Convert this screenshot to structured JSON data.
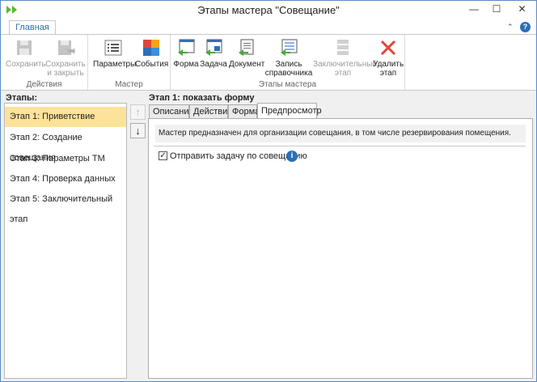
{
  "window": {
    "title": "Этапы мастера \"Совещание\""
  },
  "ribbon": {
    "tab_home": "Главная",
    "groups": {
      "actions": "Действия",
      "master": "Мастер",
      "stages": "Этапы мастера"
    },
    "buttons": {
      "save": "Сохранить",
      "save_close_1": "Сохранить",
      "save_close_2": "и закрыть",
      "params": "Параметры",
      "events": "События",
      "form": "Форма",
      "task": "Задача",
      "document": "Документ",
      "record_1": "Запись",
      "record_2": "справочника",
      "final_1": "Заключительный",
      "final_2": "этап",
      "delete_1": "Удалить",
      "delete_2": "этап"
    }
  },
  "steps": {
    "header": "Этапы:",
    "items": [
      {
        "label": "Этап 1: Приветствие",
        "selected": true
      },
      {
        "label": "Этап 2: Создание совещания",
        "selected": false
      },
      {
        "label": "Этап 3: Параметры ТМ",
        "selected": false
      },
      {
        "label": "Этап 4: Проверка данных",
        "selected": false
      },
      {
        "label": "Этап 5: Заключительный этап",
        "selected": false
      }
    ]
  },
  "stage": {
    "title": "Этап 1: показать форму",
    "tabs": [
      "Описание",
      "Действия",
      "Форма",
      "Предпросмотр"
    ],
    "active_tab": "Предпросмотр",
    "description": "Мастер предназначен для организации совещания, в том числе  резервирования помещения.",
    "checkbox_label": "Отправить задачу по совещанию",
    "checkbox_checked": true
  },
  "icons": {
    "app": "double-arrow-icon",
    "help": "help-icon",
    "info": "info-icon"
  },
  "colors": {
    "accent": "#2a6fb8",
    "selected_row": "#fde29a",
    "delete_red": "#e0463a"
  }
}
